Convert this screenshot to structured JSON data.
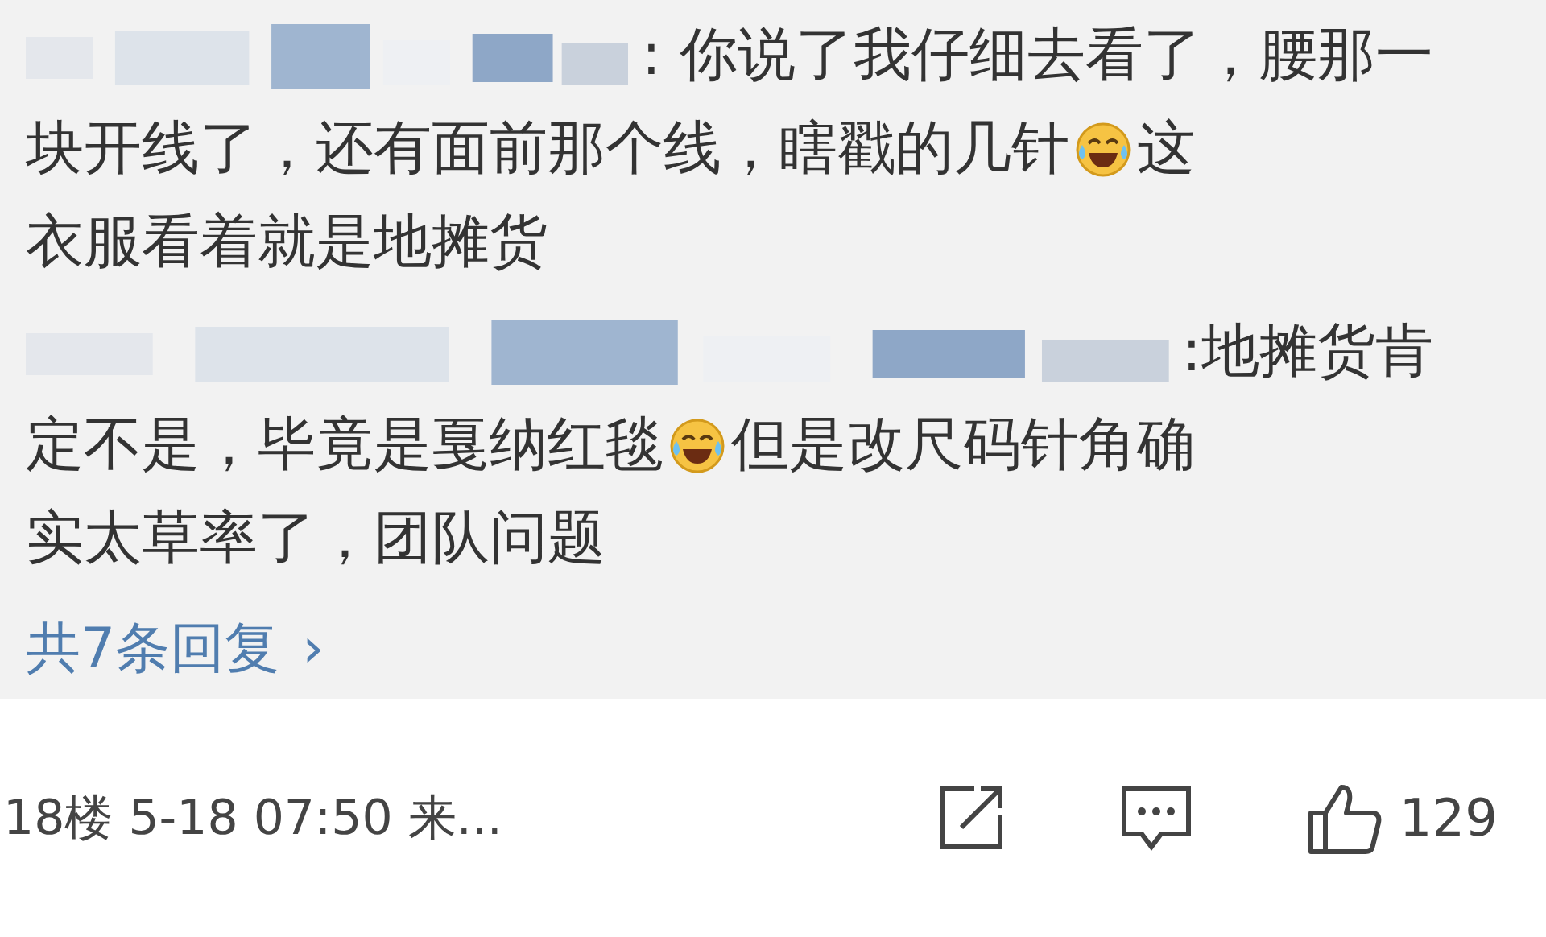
{
  "replies": [
    {
      "lines": [
        [
          {
            "kind": "blurred"
          },
          {
            "kind": "text",
            "text": ": 你说了我仔细去看了，腰那一"
          }
        ],
        [
          {
            "kind": "text",
            "text": "块开线了，还有面前那个线，瞎戳的几针"
          },
          {
            "kind": "emoji"
          },
          {
            "kind": "text",
            "text": "这"
          }
        ],
        [
          {
            "kind": "text",
            "text": "衣服看着就是地摊货"
          }
        ]
      ]
    },
    {
      "lines": [
        [
          {
            "kind": "blurred"
          },
          {
            "kind": "text",
            "text": ":地摊货肯"
          }
        ],
        [
          {
            "kind": "text",
            "text": "定不是，毕竟是戛纳红毯"
          },
          {
            "kind": "emoji"
          },
          {
            "kind": "text",
            "text": "但是改尺码针角确"
          }
        ],
        [
          {
            "kind": "text",
            "text": "实太草率了，团队问题"
          }
        ]
      ]
    }
  ],
  "more_replies": {
    "label": "共7条回复",
    "chevron": "›"
  },
  "footer": {
    "meta": "18楼 5-18 07:50 来...",
    "like_count": "129"
  }
}
